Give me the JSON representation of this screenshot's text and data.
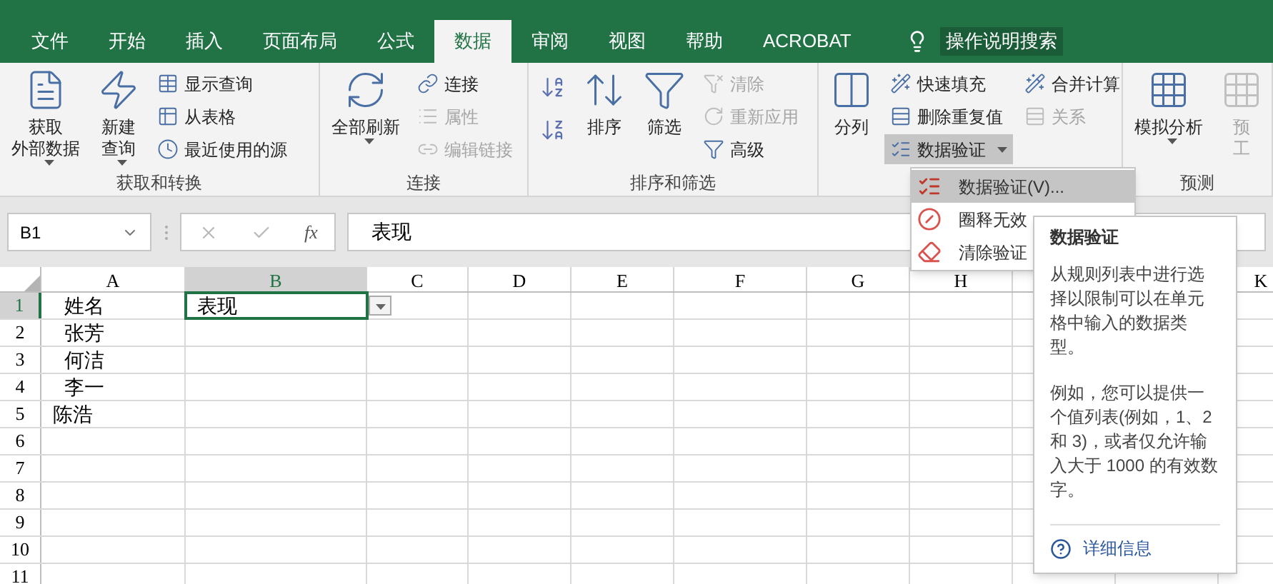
{
  "tabs": [
    {
      "label": "文件",
      "selected": false
    },
    {
      "label": "开始",
      "selected": false
    },
    {
      "label": "插入",
      "selected": false
    },
    {
      "label": "页面布局",
      "selected": false
    },
    {
      "label": "公式",
      "selected": false
    },
    {
      "label": "数据",
      "selected": true
    },
    {
      "label": "审阅",
      "selected": false
    },
    {
      "label": "视图",
      "selected": false
    },
    {
      "label": "帮助",
      "selected": false
    },
    {
      "label": "ACROBAT",
      "selected": false
    }
  ],
  "tell_me": {
    "label": "操作说明搜索"
  },
  "ribbon": {
    "groups": [
      {
        "label": "获取和转换",
        "items": [
          {
            "kind": "large",
            "label": "获取",
            "label2": "外部数据",
            "dropdown": true,
            "disabled": false
          },
          {
            "kind": "large",
            "label": "新建",
            "label2": "查询",
            "dropdown": true,
            "disabled": false
          },
          {
            "kind": "stack",
            "items": [
              {
                "label": "显示查询",
                "disabled": false
              },
              {
                "label": "从表格",
                "disabled": false
              },
              {
                "label": "最近使用的源",
                "disabled": false
              }
            ]
          }
        ]
      },
      {
        "label": "连接",
        "items": [
          {
            "kind": "large",
            "label": "全部刷新",
            "dropdown": true,
            "disabled": false
          },
          {
            "kind": "stack",
            "items": [
              {
                "label": "连接",
                "disabled": false
              },
              {
                "label": "属性",
                "disabled": true
              },
              {
                "label": "编辑链接",
                "disabled": true
              }
            ]
          }
        ]
      },
      {
        "label": "排序和筛选",
        "items": [
          {
            "kind": "sortpair"
          },
          {
            "kind": "large",
            "label": "排序",
            "disabled": false
          },
          {
            "kind": "large",
            "label": "筛选",
            "disabled": false
          },
          {
            "kind": "stack",
            "items": [
              {
                "label": "清除",
                "disabled": true
              },
              {
                "label": "重新应用",
                "disabled": true
              },
              {
                "label": "高级",
                "disabled": false
              }
            ]
          }
        ]
      },
      {
        "items": [
          {
            "kind": "large",
            "label": "分列",
            "disabled": false
          },
          {
            "kind": "stack",
            "items": [
              {
                "label": "快速填充",
                "disabled": false
              },
              {
                "label": "删除重复值",
                "disabled": false
              },
              {
                "label": "数据验证",
                "disabled": false,
                "dropdown": true,
                "pressed": true
              }
            ]
          },
          {
            "kind": "stack",
            "items": [
              {
                "label": "合并计算",
                "disabled": false
              },
              {
                "label": "关系",
                "disabled": true
              }
            ]
          }
        ]
      },
      {
        "label": "预测",
        "items": [
          {
            "kind": "large",
            "label": "模拟分析",
            "dropdown": true,
            "disabled": false
          },
          {
            "kind": "large",
            "label": "预",
            "label2": "工",
            "disabled": true
          }
        ]
      }
    ]
  },
  "formula_bar": {
    "name_box": "B1",
    "fx": "fx",
    "value": "表现"
  },
  "sheet": {
    "columns": [
      {
        "label": "A",
        "selected": false
      },
      {
        "label": "B",
        "selected": true
      },
      {
        "label": "C",
        "selected": false
      },
      {
        "label": "D",
        "selected": false
      },
      {
        "label": "E",
        "selected": false
      },
      {
        "label": "F",
        "selected": false
      },
      {
        "label": "G",
        "selected": false
      },
      {
        "label": "H",
        "selected": false
      },
      {
        "label": "K",
        "selected": false
      }
    ],
    "rows": [
      {
        "label": "1",
        "selected": true,
        "cells": [
          {
            "text": "  姓名"
          },
          {
            "text": "表现",
            "selected": true,
            "dropdown": true
          }
        ]
      },
      {
        "label": "2",
        "selected": false,
        "cells": [
          {
            "text": "  张芳"
          }
        ]
      },
      {
        "label": "3",
        "selected": false,
        "cells": [
          {
            "text": "  何洁"
          }
        ]
      },
      {
        "label": "4",
        "selected": false,
        "cells": [
          {
            "text": "  李一"
          }
        ]
      },
      {
        "label": "5",
        "selected": false,
        "cells": [
          {
            "text": "陈浩"
          }
        ]
      },
      {
        "label": "6",
        "selected": false,
        "cells": []
      },
      {
        "label": "7",
        "selected": false,
        "cells": []
      },
      {
        "label": "8",
        "selected": false,
        "cells": []
      },
      {
        "label": "9",
        "selected": false,
        "cells": []
      },
      {
        "label": "10",
        "selected": false,
        "cells": []
      },
      {
        "label": "11",
        "selected": false,
        "cells": []
      }
    ]
  },
  "menu": {
    "items": [
      {
        "label": "数据验证(V)...",
        "selected": true
      },
      {
        "label": "圈释无效",
        "selected": false
      },
      {
        "label": "清除验证",
        "selected": false
      }
    ]
  },
  "tooltip": {
    "title": "数据验证",
    "paragraphs": [
      "从规则列表中进行选择以限制可以在单元格中输入的数据类型。",
      "例如，您可以提供一个值列表(例如，1、2 和 3)，或者仅允许输入大于 1000 的有效数字。"
    ],
    "link": "详细信息"
  }
}
